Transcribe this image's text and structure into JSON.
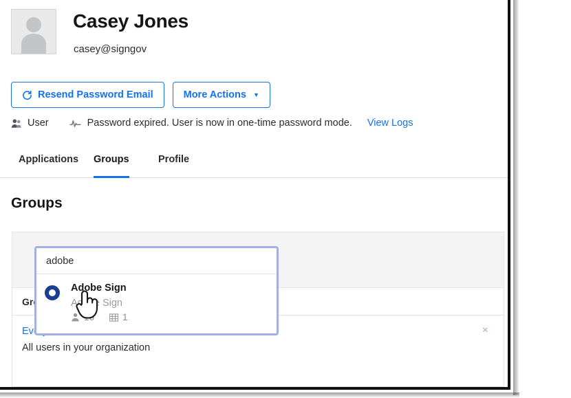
{
  "profile": {
    "name": "Casey Jones",
    "email": "casey@signgov",
    "avatar_icon": "person-placeholder-icon"
  },
  "actions": {
    "resend_label": "Resend Password Email",
    "resend_icon": "refresh-icon",
    "more_label": "More Actions",
    "more_caret": "▼"
  },
  "status": {
    "role_icon": "two-people-icon",
    "role_label": "User",
    "message_icon": "activity-pulse-icon",
    "message": "Password expired. User is now in one-time password mode.",
    "link_label": "View Logs"
  },
  "tabs": [
    {
      "label": "Applications",
      "active": false
    },
    {
      "label": "Groups",
      "active": true
    },
    {
      "label": "Profile",
      "active": false
    }
  ],
  "section": {
    "title": "Groups"
  },
  "table": {
    "header": "Group",
    "rows": [
      {
        "name": "Everyone",
        "description": "All users in your organization",
        "remove_icon": "×"
      }
    ]
  },
  "autocomplete": {
    "query": "adobe",
    "placeholder": "",
    "results": [
      {
        "title": "Adobe Sign",
        "subtitle": "Adobe Sign",
        "ring_icon": "donut-ring-icon",
        "users_icon": "person-icon",
        "users_count": "16",
        "groups_icon": "grid-icon",
        "groups_count": "1"
      }
    ]
  },
  "cursor": {
    "icon": "hand-pointer-cursor"
  },
  "colors": {
    "accent_blue": "#1473e6",
    "ring_navy": "#1b3f8f",
    "focus_border": "#a3b0e8",
    "panel_gray": "#f4f4f4",
    "text_dark": "#15161a"
  }
}
